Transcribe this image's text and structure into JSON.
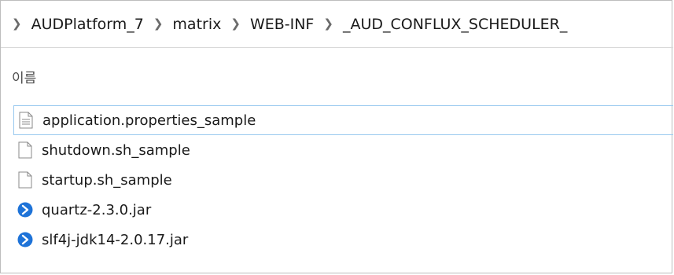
{
  "breadcrumb": [
    "AUDPlatform_7",
    "matrix",
    "WEB-INF",
    "_AUD_CONFLUX_SCHEDULER_"
  ],
  "column_header": "이름",
  "files": [
    {
      "name": "application.properties_sample",
      "icon": "text-file-icon"
    },
    {
      "name": "shutdown.sh_sample",
      "icon": "blank-file-icon"
    },
    {
      "name": "startup.sh_sample",
      "icon": "blank-file-icon"
    },
    {
      "name": "quartz-2.3.0.jar",
      "icon": "jar-file-icon"
    },
    {
      "name": "slf4j-jdk14-2.0.17.jar",
      "icon": "jar-file-icon"
    }
  ],
  "colors": {
    "focus_border": "#99c9ef",
    "jar_icon": "#1e73d8"
  }
}
